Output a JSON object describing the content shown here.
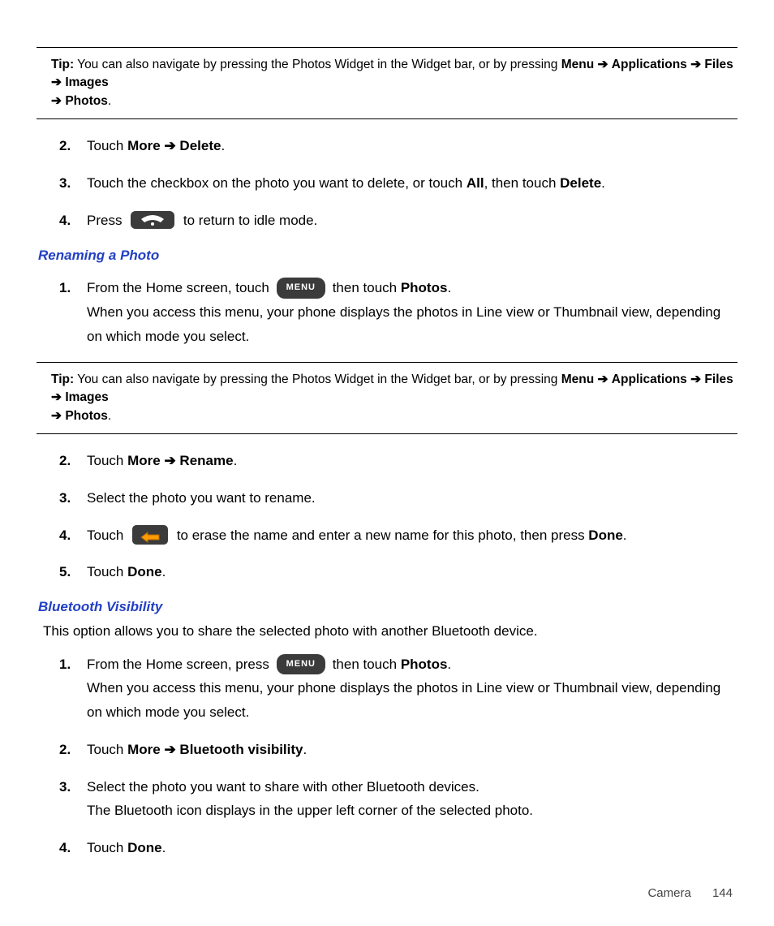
{
  "tip1": {
    "label": "Tip:",
    "text1": " You can also navigate by pressing the Photos Widget in the Widget bar, or by pressing ",
    "menu": "Menu",
    "arrow": "➔",
    "applications": "Applications",
    "files": "Files",
    "images": "Images",
    "photos": "Photos",
    "period": "."
  },
  "delete_steps": {
    "s2": {
      "num": "2.",
      "pre": "Touch ",
      "more": "More",
      "arrow": " ➔ ",
      "delete": "Delete",
      "post": "."
    },
    "s3": {
      "num": "3.",
      "pre": "Touch the checkbox on the photo you want to delete, or touch ",
      "all": "All",
      "mid": ", then touch ",
      "delete": "Delete",
      "post": "."
    },
    "s4": {
      "num": "4.",
      "pre": "Press ",
      "post": " to return to idle mode."
    }
  },
  "rename": {
    "heading": "Renaming a Photo",
    "s1": {
      "num": "1.",
      "pre": "From the Home screen, touch ",
      "menu_label": "MENU",
      "mid": " then touch ",
      "photos": "Photos",
      "post": ".",
      "line2": "When you access this menu, your phone displays the photos in Line view or Thumbnail view, depending on which mode you select."
    },
    "s2": {
      "num": "2.",
      "pre": "Touch ",
      "more": "More",
      "arrow": " ➔ ",
      "rename": "Rename",
      "post": "."
    },
    "s3": {
      "num": "3.",
      "text": "Select the photo you want to rename."
    },
    "s4": {
      "num": "4.",
      "pre": "Touch ",
      "mid": " to erase the name and enter a new name for this photo, then press ",
      "done": "Done",
      "post": "."
    },
    "s5": {
      "num": "5.",
      "pre": "Touch ",
      "done": "Done",
      "post": "."
    }
  },
  "tip2": {
    "label": "Tip:",
    "text1": " You can also navigate by pressing the Photos Widget in the Widget bar, or by pressing ",
    "menu": "Menu",
    "arrow": "➔",
    "applications": "Applications",
    "files": "Files",
    "images": "Images",
    "photos": "Photos",
    "period": "."
  },
  "bt": {
    "heading": "Bluetooth Visibility",
    "intro": "This option allows you to share the selected photo with another Bluetooth device.",
    "s1": {
      "num": "1.",
      "pre": "From the Home screen, press ",
      "menu_label": "MENU",
      "mid": " then touch ",
      "photos": "Photos",
      "post": ".",
      "line2": "When you access this menu, your phone displays the photos in Line view or Thumbnail view, depending on which mode you select."
    },
    "s2": {
      "num": "2.",
      "pre": "Touch ",
      "more": "More",
      "arrow": " ➔ ",
      "btvis": "Bluetooth visibility",
      "post": "."
    },
    "s3": {
      "num": "3.",
      "line1": "Select the photo you want to share with other Bluetooth devices.",
      "line2": "The Bluetooth icon displays in the upper left corner of the selected photo."
    },
    "s4": {
      "num": "4.",
      "pre": "Touch ",
      "done": "Done",
      "post": "."
    }
  },
  "footer": {
    "section": "Camera",
    "page": "144"
  }
}
